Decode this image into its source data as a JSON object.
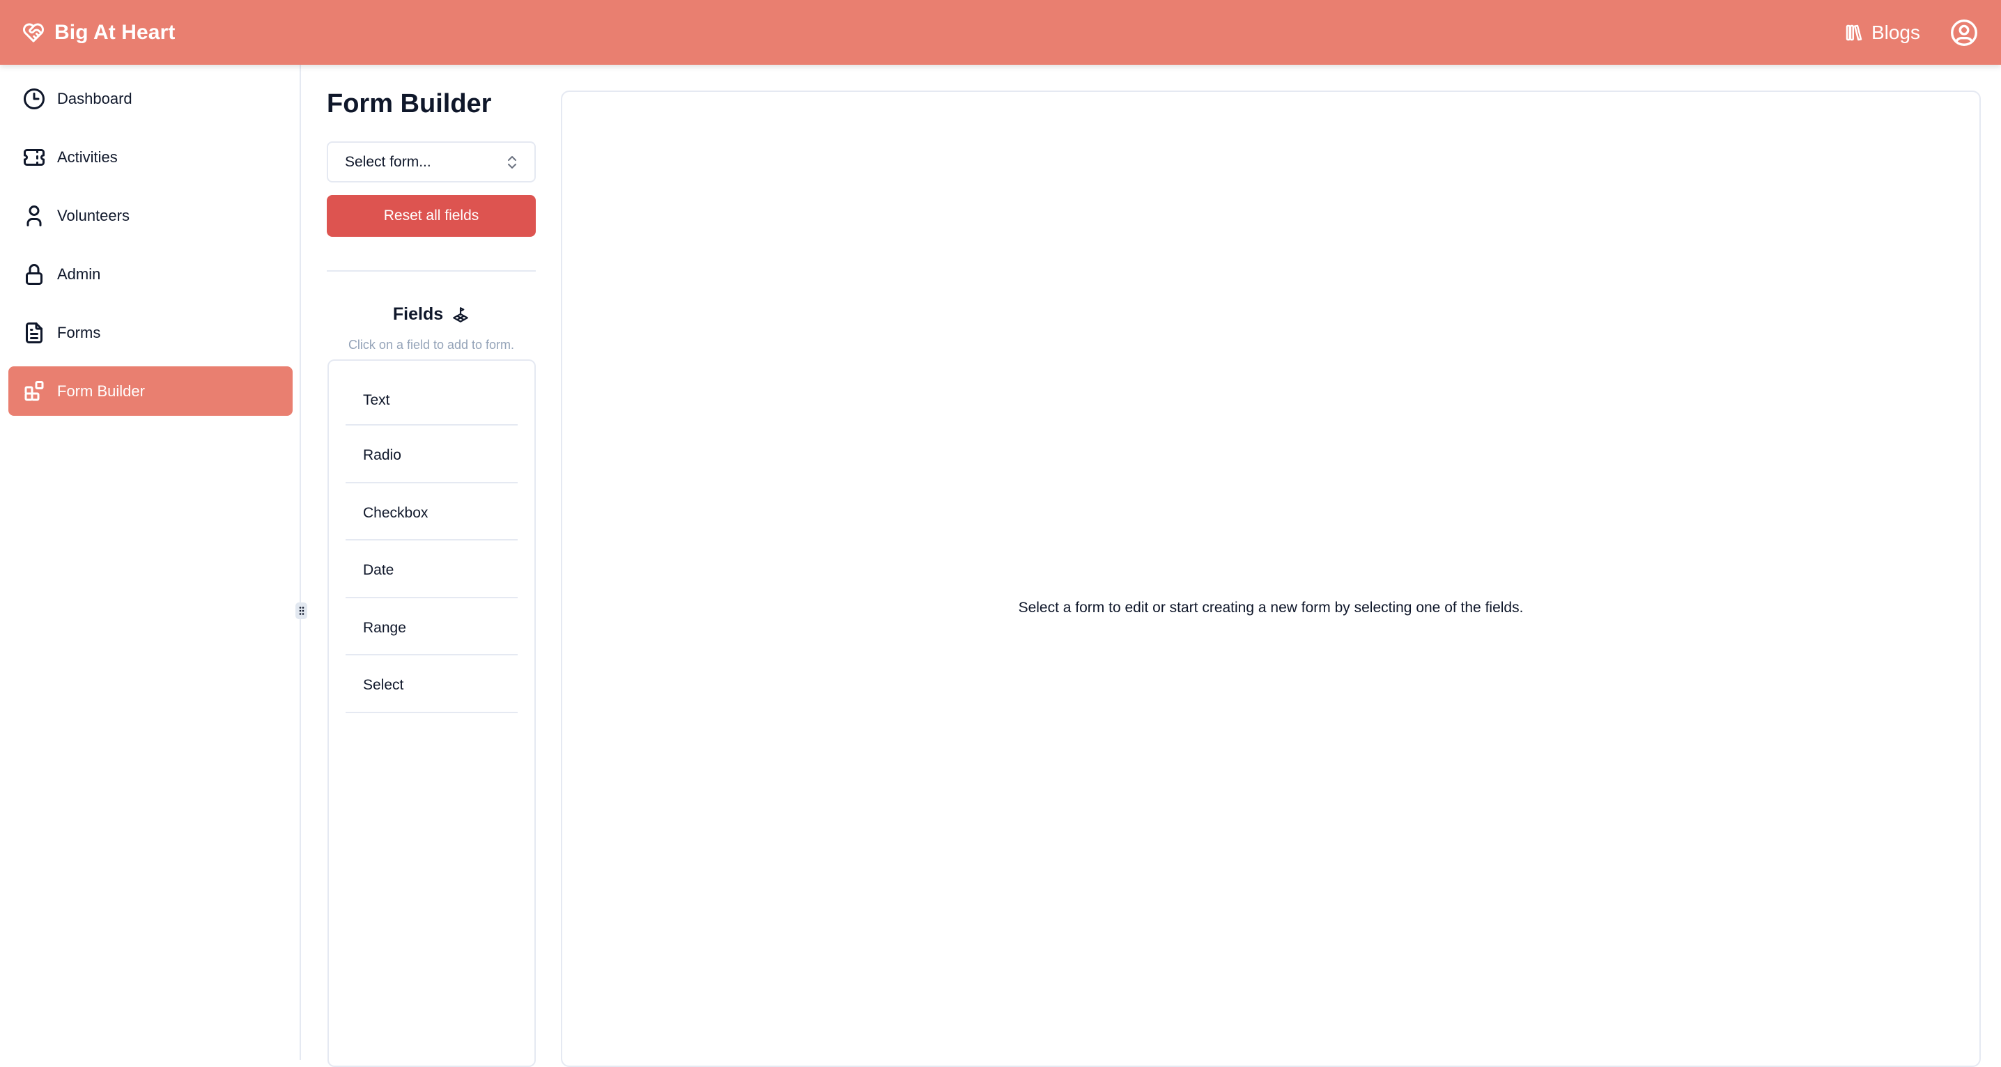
{
  "header": {
    "brand_name": "Big At Heart",
    "brand_icon": "heart-handshake-icon",
    "blogs_label": "Blogs",
    "blogs_icon": "books-icon",
    "profile_icon": "user-circle-icon",
    "color": "#e97f70"
  },
  "sidebar": {
    "items": [
      {
        "label": "Dashboard",
        "icon": "clock-icon",
        "active": false
      },
      {
        "label": "Activities",
        "icon": "ticket-icon",
        "active": false
      },
      {
        "label": "Volunteers",
        "icon": "user-icon",
        "active": false
      },
      {
        "label": "Admin",
        "icon": "lock-icon",
        "active": false
      },
      {
        "label": "Forms",
        "icon": "file-text-icon",
        "active": false
      },
      {
        "label": "Form Builder",
        "icon": "apps-icon",
        "active": true
      }
    ],
    "active_color": "#e97f70"
  },
  "builder": {
    "title": "Form Builder",
    "form_select": {
      "value": "Select form...",
      "icon": "selector-icon"
    },
    "reset_label": "Reset all fields",
    "reset_color": "#dd5450",
    "fields_heading": "Fields",
    "fields_icon": "map-flag-icon",
    "fields_hint": "Click on a field to add to form.",
    "fields": [
      "Text",
      "Radio",
      "Checkbox",
      "Date",
      "Range",
      "Select"
    ]
  },
  "canvas": {
    "empty_message": "Select a form to edit or start creating a new form by selecting one of the fields."
  }
}
